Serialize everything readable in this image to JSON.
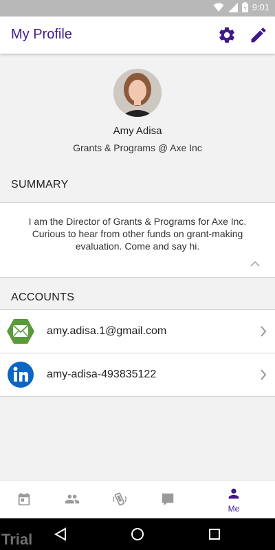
{
  "status_bar": {
    "time": "9:01"
  },
  "app_bar": {
    "title": "My Profile"
  },
  "profile": {
    "name": "Amy Adisa",
    "role": "Grants & Programs @ Axe Inc"
  },
  "summary": {
    "header": "SUMMARY",
    "text": "I am the Director of Grants & Programs for Axe Inc. Curious to hear from other funds on grant-making evaluation. Come and say hi."
  },
  "accounts": {
    "header": "ACCOUNTS",
    "items": [
      {
        "icon": "email-icon",
        "label": "amy.adisa.1@gmail.com"
      },
      {
        "icon": "linkedin-icon",
        "label": "amy-adisa-493835122"
      }
    ]
  },
  "bottom_nav": {
    "active_label": "Me",
    "items": [
      "calendar-icon",
      "people-icon",
      "shake-icon",
      "chat-icon",
      "person-icon"
    ]
  },
  "watermark": "Trial",
  "colors": {
    "accent": "#3f1a8a",
    "email_green": "#5a9a3a",
    "linkedin_blue": "#0a66c2"
  }
}
